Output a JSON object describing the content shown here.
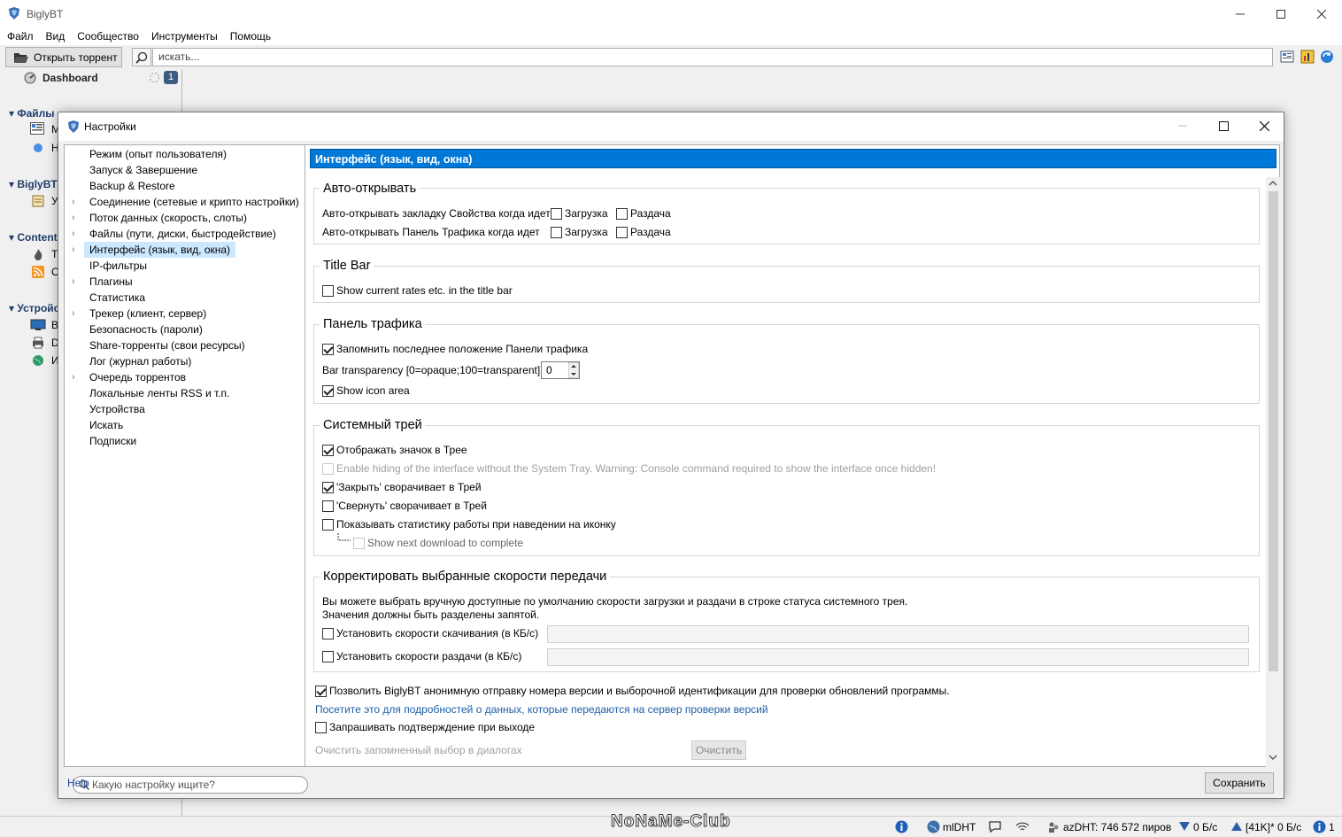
{
  "app": {
    "title": "BiglyBT"
  },
  "menu": [
    "Файл",
    "Вид",
    "Сообщество",
    "Инструменты",
    "Помощь"
  ],
  "toolbar": {
    "open_label": "Открыть торрент",
    "search_value": "искать..."
  },
  "sidebar": {
    "dashboard": "Dashboard",
    "badge": "1",
    "files": "Файлы",
    "files_letters": [
      "М",
      "Н"
    ],
    "bigly": "BiglyBT",
    "bigly_letters": [
      "У"
    ],
    "content": "Content",
    "content_letters": [
      "Т",
      "О"
    ],
    "devices": "Устройс",
    "devices_letters": [
      "В",
      "D",
      "И"
    ]
  },
  "status": {
    "mldht": "mlDHT",
    "azdht": "azDHT: 746 572 пиров",
    "down": "0 Б/с",
    "up": "[41K]* 0 Б/с",
    "count": "1"
  },
  "watermark": "NoNaMe-Club",
  "dialog": {
    "title": "Настройки",
    "tree": [
      {
        "label": "Режим (опыт пользователя)",
        "caret": false
      },
      {
        "label": "Запуск & Завершение",
        "caret": false
      },
      {
        "label": "Backup & Restore",
        "caret": false
      },
      {
        "label": "Соединение (сетевые и крипто настройки)",
        "caret": true
      },
      {
        "label": "Поток данных (скорость, слоты)",
        "caret": true
      },
      {
        "label": "Файлы (пути, диски, быстродействие)",
        "caret": true
      },
      {
        "label": "Интерфейс (язык, вид, окна)",
        "caret": true,
        "selected": true
      },
      {
        "label": "IP-фильтры",
        "caret": false
      },
      {
        "label": "Плагины",
        "caret": true
      },
      {
        "label": "Статистика",
        "caret": false
      },
      {
        "label": "Трекер (клиент, сервер)",
        "caret": true
      },
      {
        "label": "Безопасность (пароли)",
        "caret": false
      },
      {
        "label": "Share-торренты (свои ресурсы)",
        "caret": false
      },
      {
        "label": "Лог (журнал работы)",
        "caret": false
      },
      {
        "label": "Очередь торрентов",
        "caret": true
      },
      {
        "label": "Локальные ленты RSS и т.п.",
        "caret": false
      },
      {
        "label": "Устройства",
        "caret": false
      },
      {
        "label": "Искать",
        "caret": false
      },
      {
        "label": "Подписки",
        "caret": false
      }
    ],
    "tree_search_placeholder": "Какую настройку ищите?",
    "help": "Help",
    "save": "Сохранить",
    "header": "Интерфейс (язык, вид, окна)",
    "auto_open": {
      "title": "Авто-открывать",
      "row1": "Авто-открывать закладку Свойства когда идет",
      "row2": "Авто-открывать Панель Трафика когда идет",
      "download": "Загрузка",
      "seed": "Раздача"
    },
    "title_bar": {
      "title": "Title Bar",
      "show_rates": "Show current rates etc. in the title bar"
    },
    "traffic": {
      "title": "Панель трафика",
      "remember": "Запомнить последнее положение Панели трафика",
      "transparency": "Bar transparency [0=opaque;100=transparent]",
      "transparency_value": "0",
      "show_icon": "Show icon area"
    },
    "tray": {
      "title": "Системный трей",
      "show_icon": "Отображать значок в Трее",
      "enable_hiding": "Enable hiding of the interface without the System Tray. Warning: Console command required to show the interface once hidden!",
      "close_to_tray": "'Закрыть' сворачивает в Трей",
      "minimize_to_tray": "'Свернуть' сворачивает в Трей",
      "show_stats": "Показывать статистику работы при наведении на иконку",
      "show_next": "Show next download to complete"
    },
    "speeds": {
      "title": "Корректировать выбранные скорости передачи",
      "desc1": "Вы можете выбрать вручную доступные по умолчанию скорости загрузки и раздачи в строке статуса системного трея.",
      "desc2": "Значения должны быть разделены запятой.",
      "download_label": "Установить скорости скачивания (в КБ/с)",
      "upload_label": "Установить скорости раздачи (в КБ/с)"
    },
    "misc": {
      "allow_anon": "Позволить BiglyBT анонимную отправку номера версии и выборочной идентификации для проверки обновлений программы.",
      "visit_link": "Посетите это для подробностей о данных, которые передаются на сервер проверки версий",
      "confirm_exit": "Запрашивать подтверждение при выходе",
      "clear_memory": "Очистить запомненный выбор в диалогах",
      "clear_btn": "Очистить"
    }
  }
}
